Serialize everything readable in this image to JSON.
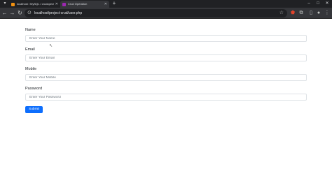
{
  "browser": {
    "tabs": [
      {
        "title": "localhost / MySQL / crudoperations",
        "active": false,
        "favicon_color": "#f29111"
      },
      {
        "title": "Crud Operation",
        "active": true,
        "favicon_color": "#9c27b0"
      }
    ],
    "new_tab_symbol": "+",
    "tab_list_symbol": "▾",
    "window_controls": {
      "minimize": "–",
      "maximize": "□",
      "close": "✕"
    },
    "address": "localhost/project-crud/user.php",
    "nav": {
      "back": "←",
      "forward": "→",
      "reload": "↻"
    }
  },
  "form": {
    "fields": [
      {
        "label": "Name",
        "placeholder": "Enter Your Name"
      },
      {
        "label": "Email",
        "placeholder": "Enter Your Email"
      },
      {
        "label": "Mobile",
        "placeholder": "Enter Your Mobile"
      },
      {
        "label": "Password",
        "placeholder": "Enter Your Password"
      }
    ],
    "submit_label": "Submit"
  },
  "colors": {
    "accent": "#0d6efd",
    "tabbar": "#202124",
    "toolbar": "#35363a"
  }
}
